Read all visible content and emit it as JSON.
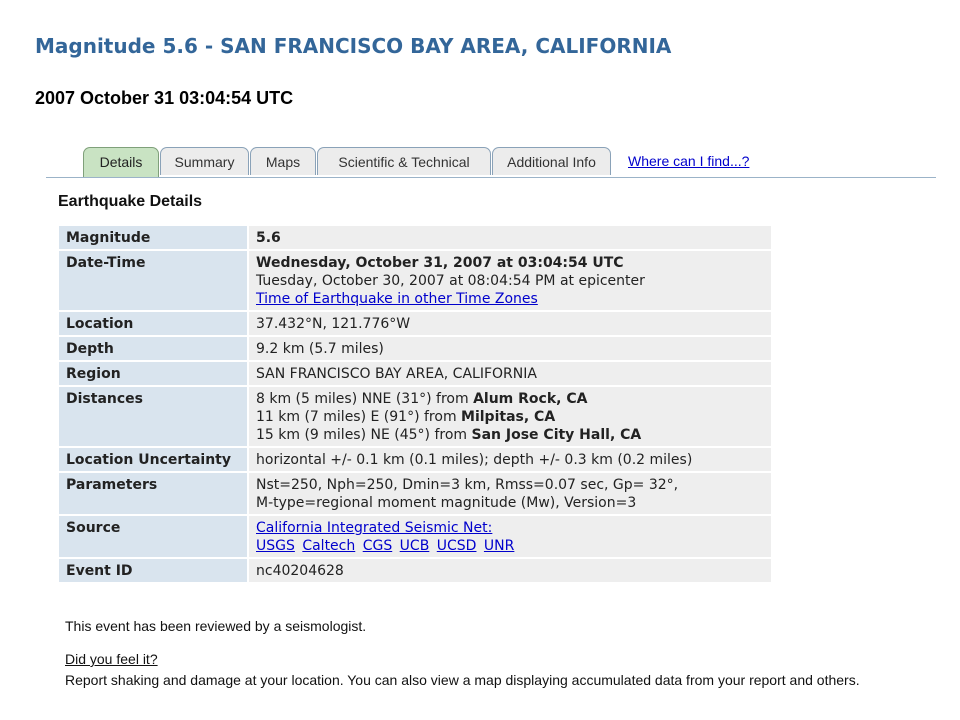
{
  "header": {
    "title": "Magnitude 5.6 - SAN FRANCISCO BAY AREA, CALIFORNIA",
    "datetime": "2007 October 31 03:04:54 UTC"
  },
  "tabs": [
    {
      "label": "Details",
      "active": true
    },
    {
      "label": "Summary",
      "active": false
    },
    {
      "label": "Maps",
      "active": false
    },
    {
      "label": "Scientific & Technical",
      "active": false
    },
    {
      "label": "Additional Info",
      "active": false
    }
  ],
  "tab_link": "Where can I find...?",
  "section_heading": "Earthquake Details",
  "details": {
    "magnitude": {
      "label": "Magnitude",
      "value": "5.6"
    },
    "datetime": {
      "label": "Date-Time",
      "utc": "Wednesday, October 31, 2007 at 03:04:54 UTC",
      "local": "Tuesday, October 30, 2007 at 08:04:54 PM at epicenter",
      "link": "Time of Earthquake in other Time Zones"
    },
    "location": {
      "label": "Location",
      "value": "37.432°N, 121.776°W"
    },
    "depth": {
      "label": "Depth",
      "value": "9.2 km (5.7 miles)"
    },
    "region": {
      "label": "Region",
      "value": "SAN FRANCISCO BAY AREA, CALIFORNIA"
    },
    "distances": {
      "label": "Distances",
      "items": [
        {
          "text": "8 km (5 miles) NNE (31°) from ",
          "place": "Alum Rock, CA"
        },
        {
          "text": "11 km (7 miles) E (91°) from ",
          "place": "Milpitas, CA"
        },
        {
          "text": "15 km (9 miles) NE (45°) from ",
          "place": "San Jose City Hall, CA"
        }
      ]
    },
    "uncertainty": {
      "label": "Location Uncertainty",
      "value": "horizontal +/- 0.1 km (0.1 miles); depth +/- 0.3 km (0.2 miles)"
    },
    "parameters": {
      "label": "Parameters",
      "line1": "Nst=250, Nph=250, Dmin=3 km, Rmss=0.07 sec, Gp= 32°,",
      "line2": "M-type=regional moment magnitude (Mw), Version=3"
    },
    "source": {
      "label": "Source",
      "network": "California Integrated Seismic Net:",
      "orgs": [
        "USGS",
        "Caltech",
        "CGS",
        "UCB",
        "UCSD",
        "UNR"
      ]
    },
    "event_id": {
      "label": "Event ID",
      "value": "nc40204628"
    }
  },
  "footer": {
    "reviewed": "This event has been reviewed by a seismologist.",
    "feel_link": "Did you feel it?",
    "report": "Report shaking and damage at your location. You can also view a map displaying accumulated data from your report and others."
  },
  "colors": {
    "title": "#336699",
    "active_tab": "#c9e3c3",
    "label_cell": "#d9e4ee",
    "value_cell": "#eeeeee",
    "link": "#0000cc"
  }
}
